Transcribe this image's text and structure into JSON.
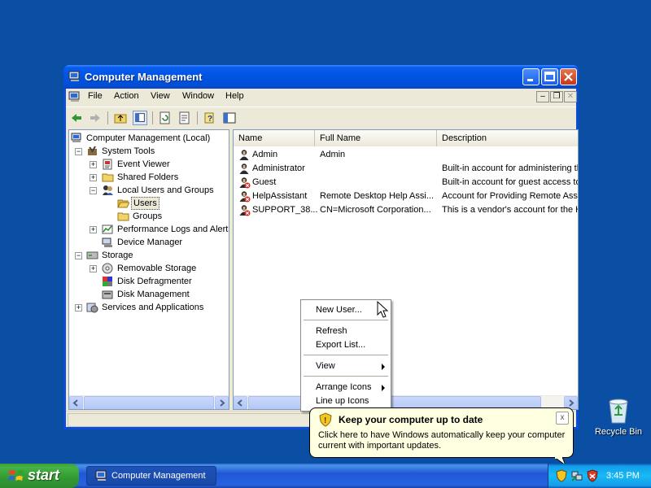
{
  "window": {
    "title": "Computer Management",
    "menu": [
      "File",
      "Action",
      "View",
      "Window",
      "Help"
    ]
  },
  "tree": {
    "nodes": [
      {
        "label": "Computer Management (Local)",
        "icon": "computer-icon"
      },
      {
        "label": "System Tools",
        "icon": "tools-icon"
      },
      {
        "label": "Event Viewer",
        "icon": "event-viewer-icon"
      },
      {
        "label": "Shared Folders",
        "icon": "folder-icon"
      },
      {
        "label": "Local Users and Groups",
        "icon": "users-icon"
      },
      {
        "label": "Users",
        "icon": "folder-open-icon",
        "selected": true
      },
      {
        "label": "Groups",
        "icon": "folder-icon"
      },
      {
        "label": "Performance Logs and Alerts",
        "icon": "performance-icon"
      },
      {
        "label": "Device Manager",
        "icon": "device-manager-icon"
      },
      {
        "label": "Storage",
        "icon": "storage-icon"
      },
      {
        "label": "Removable Storage",
        "icon": "removable-storage-icon"
      },
      {
        "label": "Disk Defragmenter",
        "icon": "defrag-icon"
      },
      {
        "label": "Disk Management",
        "icon": "disk-icon"
      },
      {
        "label": "Services and Applications",
        "icon": "services-icon"
      }
    ]
  },
  "list": {
    "columns": [
      "Name",
      "Full Name",
      "Description"
    ],
    "rows": [
      {
        "name": "Admin",
        "full_name": "Admin",
        "description": "",
        "disabled": false
      },
      {
        "name": "Administrator",
        "full_name": "",
        "description": "Built-in account for administering the",
        "disabled": false
      },
      {
        "name": "Guest",
        "full_name": "",
        "description": "Built-in account for guest access to t",
        "disabled": true
      },
      {
        "name": "HelpAssistant",
        "full_name": "Remote Desktop Help Assi...",
        "description": "Account for Providing Remote Assis",
        "disabled": true
      },
      {
        "name": "SUPPORT_38...",
        "full_name": "CN=Microsoft Corporation...",
        "description": "This is a vendor's account for the H",
        "disabled": true
      }
    ]
  },
  "context_menu": {
    "items": [
      "New User...",
      "Refresh",
      "Export List...",
      "View",
      "Arrange Icons",
      "Line up Icons"
    ]
  },
  "balloon": {
    "title": "Keep your computer up to date",
    "text": "Click here to have Windows automatically keep your computer current with important updates.",
    "close": "x"
  },
  "taskbar": {
    "start_label": "start",
    "task_label": "Computer Management",
    "clock": "3:45 PM"
  },
  "desktop": {
    "recycle_bin_label": "Recycle Bin"
  },
  "colors": {
    "desktop": "#0b4fa5",
    "titlebar": "#0054e3",
    "window_face": "#ece9d8",
    "selection": "#ece9d8",
    "balloon": "#ffffe1"
  }
}
